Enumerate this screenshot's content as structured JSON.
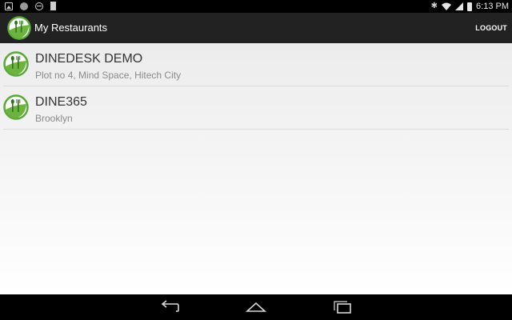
{
  "status_bar": {
    "time": "6:13 PM"
  },
  "header": {
    "title": "My Restaurants",
    "logout_label": "LOGOUT"
  },
  "restaurants": [
    {
      "name": "DINEDESK DEMO",
      "address": "Plot no 4, Mind Space, Hitech City"
    },
    {
      "name": "DINE365",
      "address": "Brooklyn"
    }
  ],
  "icons": {
    "app": "dinedesk-logo-icon",
    "nav": [
      "back-icon",
      "home-icon",
      "recent-apps-icon"
    ]
  },
  "colors": {
    "action_bar": "#222222",
    "logo_green": "#5aa83a"
  }
}
